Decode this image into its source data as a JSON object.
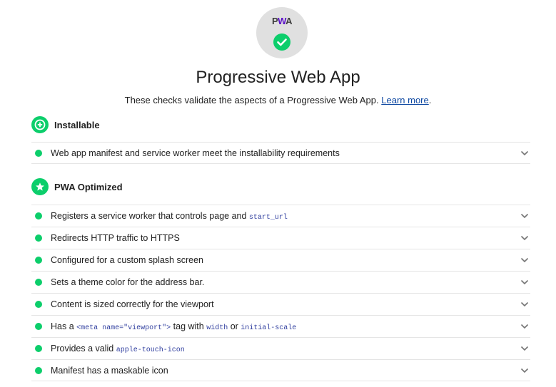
{
  "header": {
    "logo_text_1": "P",
    "logo_text_accent": "W",
    "logo_text_2": "A",
    "title": "Progressive Web App",
    "description": "These checks validate the aspects of a Progressive Web App.",
    "learn_more": "Learn more",
    "period": "."
  },
  "colors": {
    "pass": "#0cce6b",
    "gauge_bg": "#e0e0e0",
    "link": "#0d47a1",
    "code": "#303f9f"
  },
  "groups": {
    "installable": {
      "title": "Installable",
      "icon": "plus-circle-icon",
      "audits": [
        {
          "text": "Web app manifest and service worker meet the installability requirements"
        }
      ]
    },
    "optimized": {
      "title": "PWA Optimized",
      "icon": "star-circle-icon",
      "audits": [
        {
          "text": "Registers a service worker that controls page and ",
          "code1": "start_url"
        },
        {
          "text": "Redirects HTTP traffic to HTTPS"
        },
        {
          "text": "Configured for a custom splash screen"
        },
        {
          "text": "Sets a theme color for the address bar."
        },
        {
          "text": "Content is sized correctly for the viewport"
        },
        {
          "t1": "Has a ",
          "code1": "<meta name=\"viewport\">",
          "t2": " tag with ",
          "code2": "width",
          "t3": " or ",
          "code3": "initial-scale"
        },
        {
          "text": "Provides a valid ",
          "code1": "apple-touch-icon"
        },
        {
          "text": "Manifest has a maskable icon"
        }
      ]
    }
  }
}
